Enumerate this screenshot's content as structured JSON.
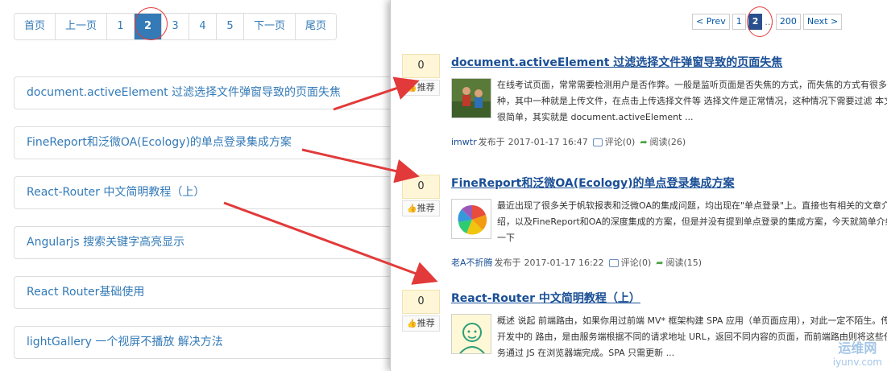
{
  "left": {
    "pagination": {
      "first": "首页",
      "prev": "上一页",
      "pages": [
        "1",
        "2",
        "3",
        "4",
        "5"
      ],
      "active_page": "2",
      "next": "下一页",
      "last": "尾页"
    },
    "articles": [
      "document.activeElement 过滤选择文件弹窗导致的页面失焦",
      "FineReport和泛微OA(Ecology)的单点登录集成方案",
      "React-Router 中文简明教程（上）",
      "Angularjs 搜索关键字高亮显示",
      "React Router基础使用",
      "lightGallery 一个视屏不播放 解决方法"
    ]
  },
  "right": {
    "pagination": {
      "prev": "< Prev",
      "page_1": "1",
      "page_2": "2",
      "dots": "...",
      "page_last": "200",
      "next": "Next >"
    },
    "vote_label": "推荐",
    "posts": [
      {
        "votes": "0",
        "title": "document.activeElement 过滤选择文件弹窗导致的页面失焦",
        "summary": "在线考试页面，常常需要检测用户是否作弊。一般是监听页面是否失焦的方式，而失焦的方式有很多种，其中一种就是上传文件，在点击上传选择文件等 选择文件是正常情况，这种情况下需要过滤 本文很简单，其实就是 document.activeElement ...",
        "author": "imwtr",
        "published_label": "发布于",
        "date": "2017-01-17 16:47",
        "comments": "评论(0)",
        "reads": "阅读(26)"
      },
      {
        "votes": "0",
        "title": "FineReport和泛微OA(Ecology)的单点登录集成方案",
        "summary": "最近出现了很多关于帆软报表和泛微OA的集成问题，均出现在\"单点登录\"上。直接也有相关的文章介绍，以及FineReport和OA的深度集成的方案，但是并没有提到单点登录的集成方案，今天就简单介绍一下",
        "author": "老A不折腾",
        "published_label": "发布于",
        "date": "2017-01-17 16:22",
        "comments": "评论(0)",
        "reads": "阅读(15)"
      },
      {
        "votes": "0",
        "title": "React-Router 中文简明教程（上）",
        "summary": "概述 说起 前端路由，如果你用过前端 MV* 框架构建 SPA 应用（单页面应用），对此一定不陌生。传统开发中的 路由，是由服务端根据不同的请求地址 URL，返回不同内容的页面，而前端路由则将这些任务通过 JS 在浏览器端完成。SPA 只需更新 ..."
      }
    ]
  },
  "watermark": {
    "cn": "运维网",
    "en": "iyunv.com"
  },
  "colors": {
    "link": "#337ab7",
    "title_link": "#1a4f96",
    "active_page": "#337ab7",
    "annotation": "#e23a3a"
  }
}
